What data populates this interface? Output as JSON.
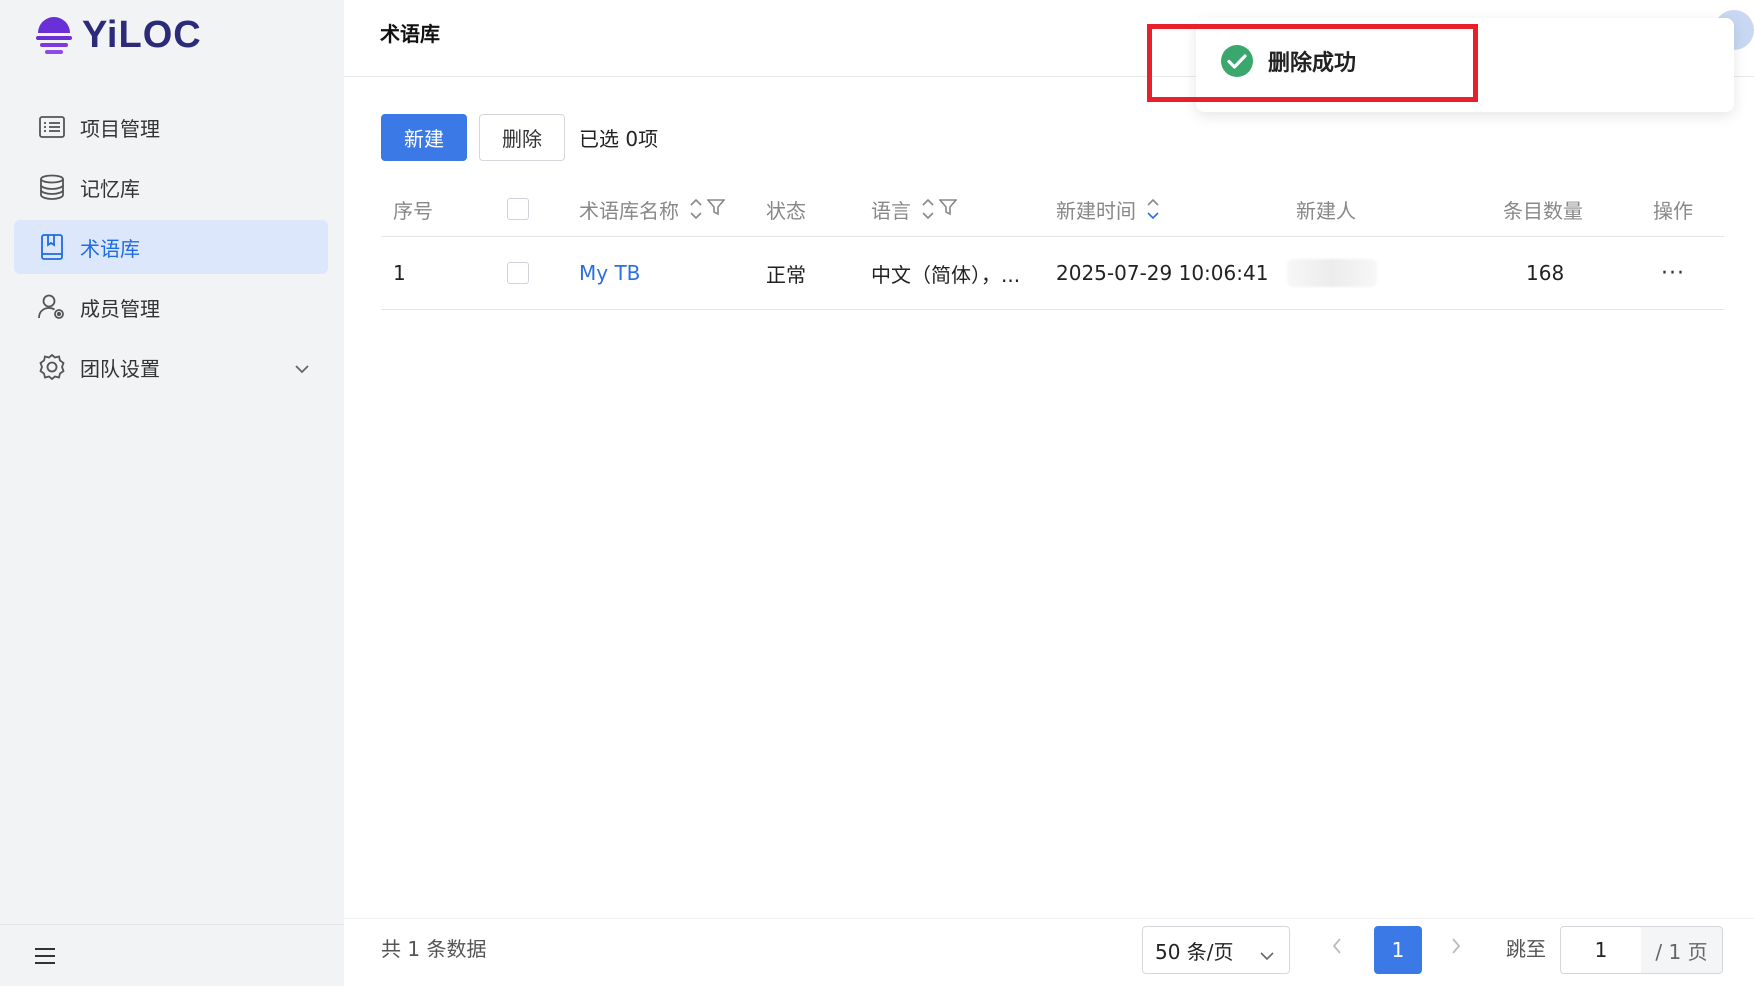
{
  "app": {
    "logo_text": "YiLOC"
  },
  "sidebar": {
    "items": [
      {
        "label": "项目管理",
        "icon": "list-icon"
      },
      {
        "label": "记忆库",
        "icon": "database-icon"
      },
      {
        "label": "术语库",
        "icon": "book-icon",
        "active": true
      },
      {
        "label": "成员管理",
        "icon": "user-icon"
      },
      {
        "label": "团队设置",
        "icon": "gear-icon"
      }
    ]
  },
  "header": {
    "title": "术语库"
  },
  "toolbar": {
    "new_label": "新建",
    "delete_label": "删除",
    "selected": "已选 0项"
  },
  "table": {
    "columns": {
      "index": "序号",
      "name": "术语库名称",
      "status": "状态",
      "language": "语言",
      "created": "新建时间",
      "creator": "新建人",
      "count": "条目数量",
      "actions": "操作"
    },
    "rows": [
      {
        "index": "1",
        "name": "My TB",
        "status": "正常",
        "language": "中文（简体），...",
        "created": "2025-07-29 10:06:41",
        "count": "168",
        "actions": "···"
      }
    ]
  },
  "footer": {
    "total": "共 1 条数据",
    "page_size": "50 条/页",
    "current_page": "1",
    "jump_label": "跳至",
    "jump_value": "1",
    "page_total": "/ 1 页"
  },
  "toast": {
    "message": "删除成功"
  },
  "colors": {
    "primary": "#3b7ae6",
    "active_bg": "#dde7fb",
    "success": "#3aa76d",
    "highlight": "#e8202a"
  }
}
